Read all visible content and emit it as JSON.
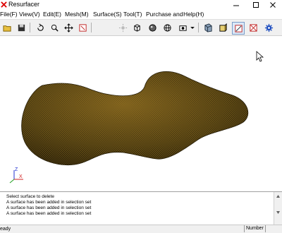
{
  "window": {
    "title": "Resurfacer"
  },
  "menu": [
    "File(F)",
    "View(V)",
    "Edit(E)",
    "Mesh(M)",
    "Surface(S)",
    "Tool(T)",
    "Purchase and",
    "Help(H)"
  ],
  "toolbar": [
    {
      "name": "open-folder-icon"
    },
    {
      "name": "save-icon"
    },
    {
      "name": "rotate-icon"
    },
    {
      "name": "zoom-icon"
    },
    {
      "name": "pan-icon"
    },
    {
      "name": "zoom-window-icon"
    },
    {
      "name": "sun-icon"
    },
    {
      "name": "cube-view-icon"
    },
    {
      "name": "shaded-sphere-icon"
    },
    {
      "name": "wire-sphere-icon"
    },
    {
      "name": "camera-icon"
    },
    {
      "name": "dropdown-arrow-icon"
    },
    {
      "name": "mesh-display-icon"
    },
    {
      "name": "box-view-icon"
    },
    {
      "name": "select-icon"
    },
    {
      "name": "cross-select-icon"
    },
    {
      "name": "settings-gear-icon"
    }
  ],
  "viewport": {
    "model_color": "#4a3a10",
    "mesh_color": "#b8892a",
    "triad": [
      "Z",
      "X"
    ]
  },
  "output_lines": [
    "Select surface to delete",
    "A surface has been added in selection set",
    "A surface has been added in selection set",
    "A surface has been added in selection set"
  ],
  "status": {
    "left": "eady",
    "right": "Number"
  }
}
